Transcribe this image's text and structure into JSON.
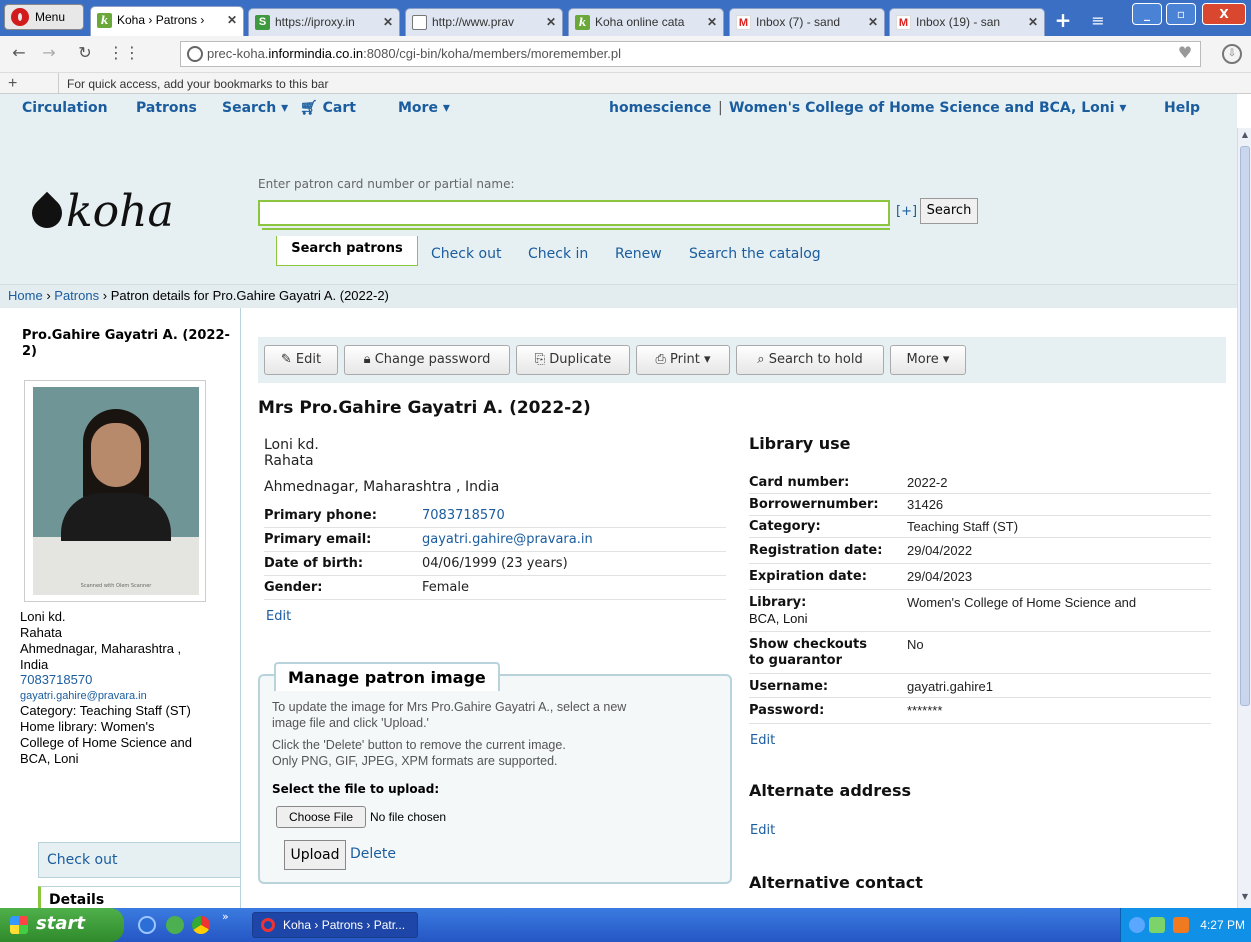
{
  "browser": {
    "menu_label": "Menu",
    "tabs": [
      {
        "label": "Koha › Patrons ›",
        "icon": "koha-icon"
      },
      {
        "label": "https://iproxy.in",
        "icon": "proxy-icon"
      },
      {
        "label": "http://www.prav",
        "icon": "page-icon"
      },
      {
        "label": "Koha online cata",
        "icon": "koha-icon"
      },
      {
        "label": "Inbox (7) - sand",
        "icon": "gmail-icon"
      },
      {
        "label": "Inbox (19) - san",
        "icon": "gmail-icon"
      }
    ],
    "tab_close": "✕",
    "url_host_prefix": "prec-koha.",
    "url_host_main": "informindia.co.in",
    "url_path": ":8080/cgi-bin/koha/members/moremember.pl",
    "bookmarks_hint": "For quick access, add your bookmarks to this bar"
  },
  "nav": {
    "circulation": "Circulation",
    "patrons": "Patrons",
    "search": "Search ▾",
    "cart": "Cart",
    "more": "More ▾",
    "user": "homescience",
    "separator": "|",
    "library": "Women's College of Home Science and BCA, Loni ▾",
    "help": "Help"
  },
  "header": {
    "logo_text": "koha",
    "search_label": "Enter patron card number or partial name:",
    "search_value": "",
    "search_plus": "[+]",
    "search_button": "Search",
    "tabs": {
      "search_patrons": "Search patrons",
      "check_out": "Check out",
      "check_in": "Check in",
      "renew": "Renew",
      "search_catalog": "Search the catalog"
    }
  },
  "breadcrumb": {
    "home": "Home",
    "patrons": "Patrons",
    "sep": "›",
    "current": "Patron details for Pro.Gahire Gayatri A. (2022-2)"
  },
  "sidebar": {
    "name": "Pro.Gahire Gayatri A. (2022-2)",
    "photo_caption": "Scanned with Olem Scanner",
    "address1": "Loni kd.",
    "address2": "Rahata",
    "address3": "Ahmednagar, Maharashtra ,",
    "address4": "India",
    "phone": "7083718570",
    "email": "gayatri.gahire@pravara.in",
    "category": "Category: Teaching Staff (ST)",
    "home_library_1": "Home library: Women's",
    "home_library_2": "College of Home Science and",
    "home_library_3": "BCA, Loni",
    "nav_checkout": "Check out",
    "nav_details": "Details"
  },
  "toolbar": {
    "edit": "Edit",
    "change_password": "Change password",
    "duplicate": "Duplicate",
    "print": "Print ▾",
    "search_to_hold": "Search to hold",
    "more": "More ▾"
  },
  "patron": {
    "title": "Mrs Pro.Gahire Gayatri A. (2022-2)",
    "address1": "Loni kd.",
    "address2": "Rahata",
    "address3": "Ahmednagar, Maharashtra , India",
    "fields": [
      {
        "label": "Primary phone:",
        "value": "7083718570"
      },
      {
        "label": "Primary email:",
        "value": "gayatri.gahire@pravara.in"
      },
      {
        "label": "Date of birth:",
        "value": "04/06/1999 (23 years)"
      },
      {
        "label": "Gender:",
        "value": "Female"
      }
    ],
    "edit": "Edit"
  },
  "manage_image": {
    "legend": "Manage patron image",
    "line1": "To update the image for Mrs Pro.Gahire Gayatri A., select a new",
    "line2": "image file and click 'Upload.'",
    "line3": "Click the 'Delete' button to remove the current image.",
    "line4": "Only PNG, GIF, JPEG, XPM formats are supported.",
    "select_label": "Select the file to upload:",
    "choose_file": "Choose File",
    "no_file": "No file chosen",
    "upload": "Upload",
    "delete": "Delete"
  },
  "library_use": {
    "heading": "Library use",
    "rows": [
      {
        "label": "Card number:",
        "value": "2022-2"
      },
      {
        "label": "Borrowernumber:",
        "value": "31426"
      },
      {
        "label": "Category:",
        "value": "Teaching Staff (ST)"
      },
      {
        "label": "Registration date:",
        "value": "29/04/2022"
      },
      {
        "label": "Expiration date:",
        "value": "29/04/2023"
      },
      {
        "label": "Library:",
        "label2": "BCA, Loni",
        "value": "Women's College of Home Science and"
      },
      {
        "label": "Show checkouts",
        "label2": "to guarantor",
        "value": "No"
      },
      {
        "label": "Username:",
        "value": "gayatri.gahire1"
      },
      {
        "label": "Password:",
        "value": "*******"
      }
    ],
    "edit": "Edit"
  },
  "alternate_address": {
    "heading": "Alternate address",
    "edit": "Edit"
  },
  "alternative_contact": {
    "heading": "Alternative contact"
  },
  "taskbar": {
    "start": "start",
    "task": "Koha › Patrons › Patr...",
    "clock": "4:27 PM",
    "chevron": "»"
  }
}
